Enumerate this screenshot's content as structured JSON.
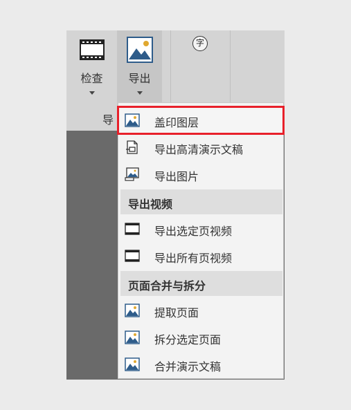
{
  "ribbon": {
    "check_label": "检查",
    "export_label": "导出",
    "char_icon_glyph": "字",
    "group_label": "导"
  },
  "menu": {
    "items_top": [
      {
        "label": "盖印图层",
        "icon": "image-icon",
        "highlighted": true
      },
      {
        "label": "导出高清演示文稿",
        "icon": "document-export-icon"
      },
      {
        "label": "导出图片",
        "icon": "picture-export-icon"
      }
    ],
    "section_video": "导出视频",
    "items_video": [
      {
        "label": "导出选定页视频",
        "icon": "film-icon"
      },
      {
        "label": "导出所有页视频",
        "icon": "film-icon"
      }
    ],
    "section_merge": "页面合并与拆分",
    "items_merge": [
      {
        "label": "提取页面",
        "icon": "image-icon"
      },
      {
        "label": "拆分选定页面",
        "icon": "image-icon"
      },
      {
        "label": "合并演示文稿",
        "icon": "image-icon"
      }
    ]
  },
  "colors": {
    "highlight_border": "#e8202a",
    "image_icon_blue": "#2e5c8a",
    "image_icon_sun": "#e0a830"
  }
}
